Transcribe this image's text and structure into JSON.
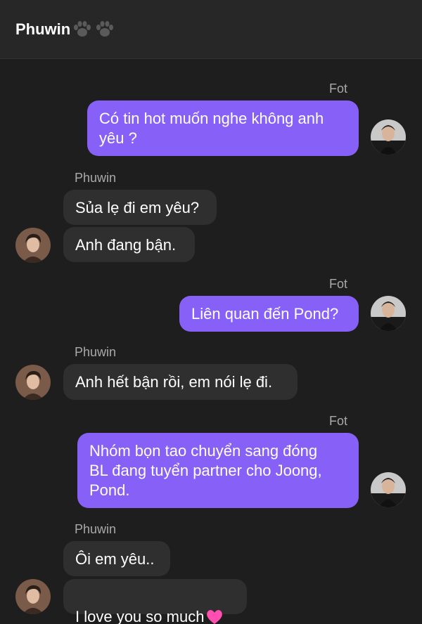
{
  "header": {
    "title": "Phuwin",
    "title_icons": [
      "paw-icon",
      "paw-icon"
    ]
  },
  "messages": [
    {
      "sender": "Fot",
      "side": "right",
      "text": "Có tin hot muốn nghe không anh\nyêu ?"
    },
    {
      "sender": "Phuwin",
      "side": "left",
      "text": "Sủa lẹ đi em yêu?"
    },
    {
      "sender": "Phuwin",
      "side": "left",
      "text": "Anh đang bận."
    },
    {
      "sender": "Fot",
      "side": "right",
      "text": "Liên quan đến Pond?"
    },
    {
      "sender": "Phuwin",
      "side": "left",
      "text": "Anh hết bận rồi, em nói lẹ đi."
    },
    {
      "sender": "Fot",
      "side": "right",
      "text": "Nhóm bọn tao chuyển sang đóng\nBL đang tuyển partner cho Joong,\nPond."
    },
    {
      "sender": "Phuwin",
      "side": "left",
      "text": "Ôi em yêu.."
    },
    {
      "sender": "Phuwin",
      "side": "left",
      "text": "I love you so much",
      "emoji": "pink-heart-icon"
    }
  ],
  "colors": {
    "outgoing_bubble": "#8761f7",
    "incoming_bubble": "#2f2f2f",
    "background": "#1e1e1e",
    "header": "#272727"
  }
}
